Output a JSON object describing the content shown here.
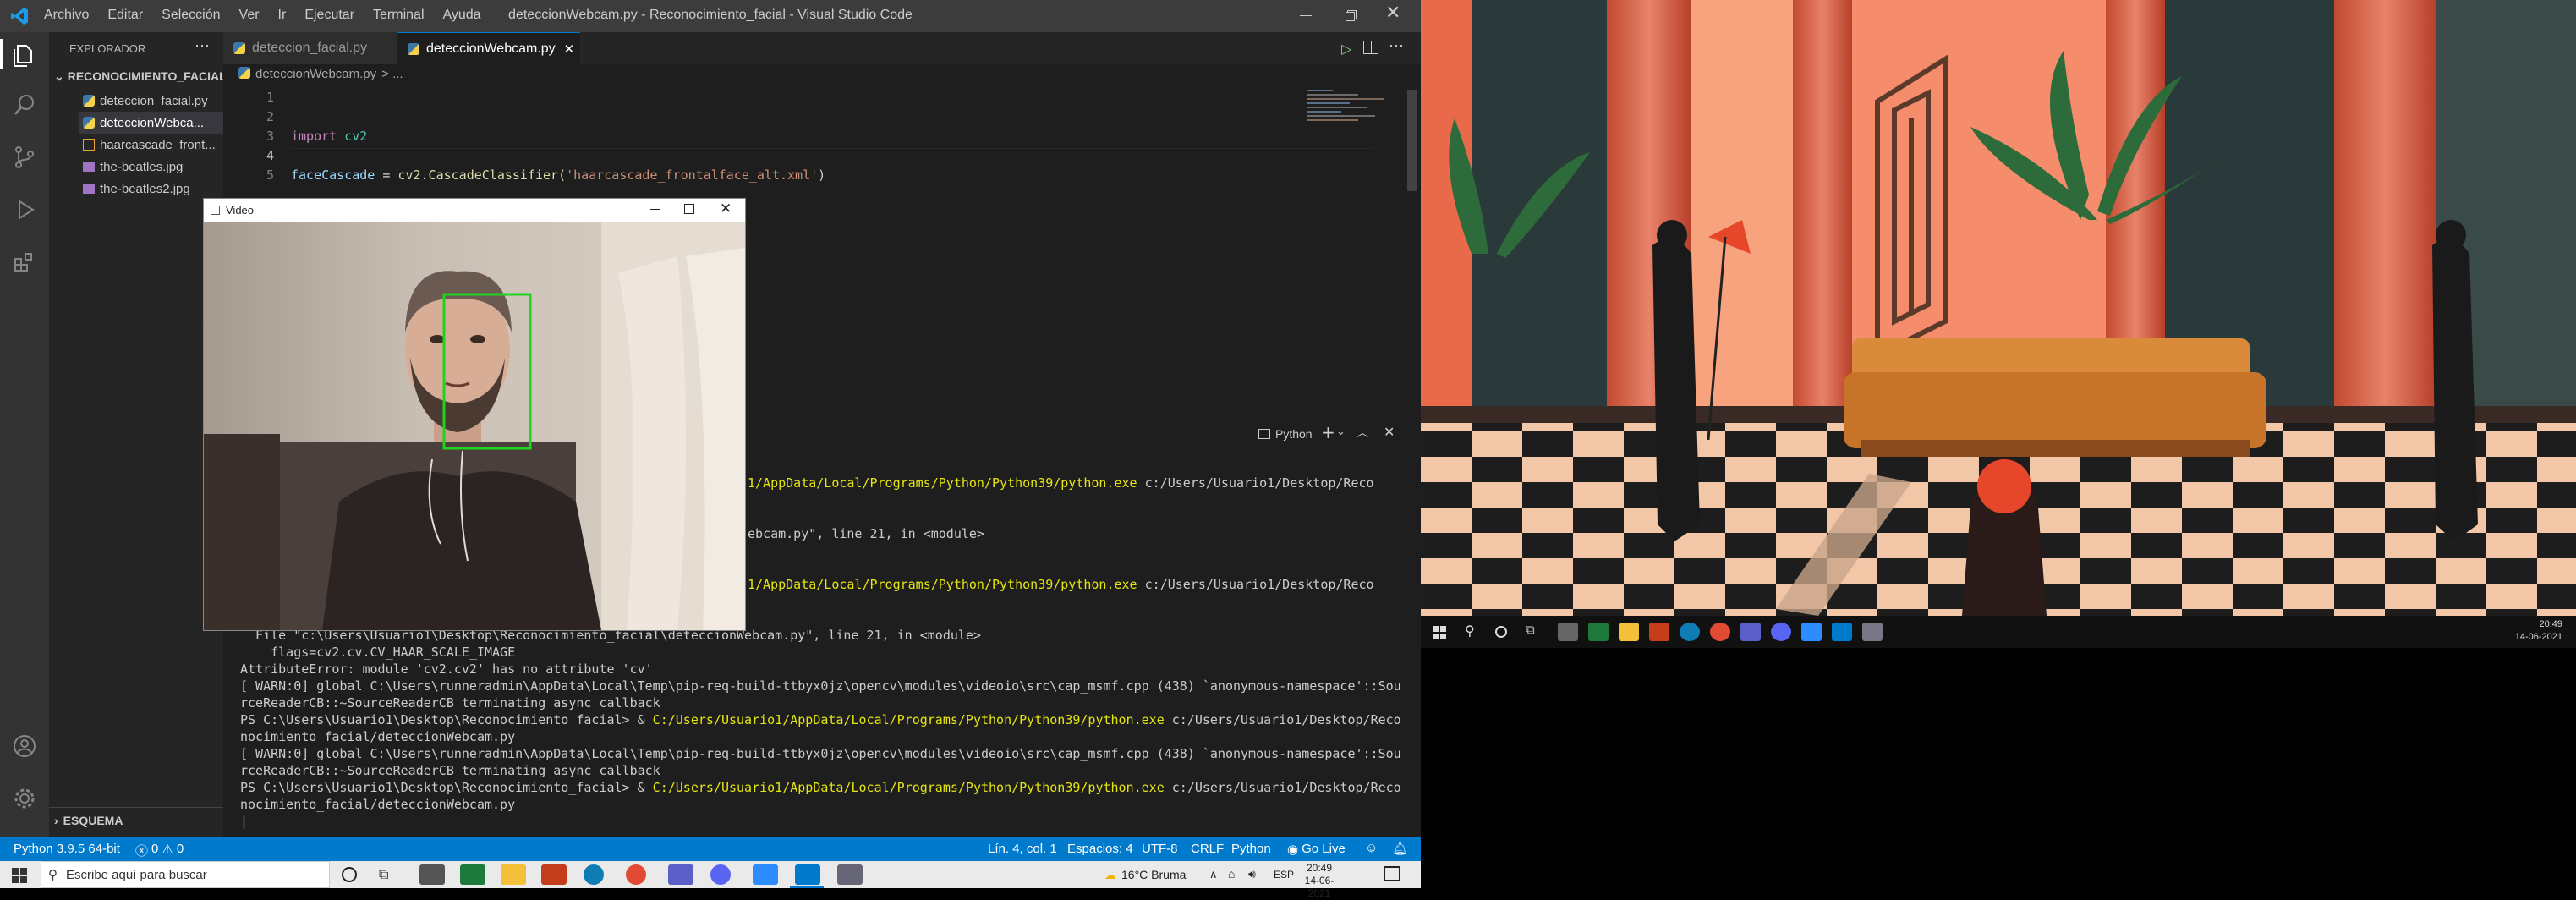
{
  "app": {
    "window_title": "deteccionWebcam.py - Reconocimiento_facial - Visual Studio Code"
  },
  "menu": [
    "Archivo",
    "Editar",
    "Selección",
    "Ver",
    "Ir",
    "Ejecutar",
    "Terminal",
    "Ayuda"
  ],
  "sidebar": {
    "header": "EXPLORADOR",
    "folder": "RECONOCIMIENTO_FACIAL",
    "files": [
      "deteccion_facial.py",
      "deteccionWebca...",
      "haarcascade_front...",
      "the-beatles.jpg",
      "the-beatles2.jpg"
    ],
    "outline": "ESQUEMA"
  },
  "tabs": [
    {
      "label": "deteccion_facial.py"
    },
    {
      "label": "deteccionWebcam.py"
    }
  ],
  "breadcrumb": {
    "file": "deteccionWebcam.py",
    "rest": "> ..."
  },
  "editor": {
    "line_numbers": [
      "1",
      "2",
      "3",
      "4",
      "5"
    ],
    "import_kw": "import",
    "import_mod": "cv2",
    "assign_var": "faceCascade",
    "assign_eq": " = ",
    "assign_call": "cv2.CascadeClassifier(",
    "assign_str": "'haarcascade_frontalface_alt.xml'",
    "assign_close": ")"
  },
  "video_window": {
    "title": "Video"
  },
  "panel": {
    "terminal_label": "Python"
  },
  "terminal": {
    "partial1a": "1/AppData/Local/Programs/Python/Python39/python.exe",
    "partial1b": " c:/Users/Usuario1/Desktop/Reco",
    "partial2": "ebcam.py\", line 21, in <module>",
    "partial3a": "1/AppData/Local/Programs/Python/Python39/python.exe",
    "partial3b": " c:/Users/Usuario1/Desktop/Reco",
    "lines": [
      "  File \"c:\\Users\\Usuario1\\Desktop\\Reconocimiento_facial\\deteccionWebcam.py\", line 21, in <module>",
      "    flags=cv2.cv.CV_HAAR_SCALE_IMAGE",
      "AttributeError: module 'cv2.cv2' has no attribute 'cv'",
      "[ WARN:0] global C:\\Users\\runneradmin\\AppData\\Local\\Temp\\pip-req-build-ttbyx0jz\\opencv\\modules\\videoio\\src\\cap_msmf.cpp (438) `anonymous-namespace'::Sou",
      "rceReaderCB::~SourceReaderCB terminating async callback"
    ],
    "ps_prefix": "PS C:\\Users\\Usuario1\\Desktop\\Reconocimiento_facial> & ",
    "ps_cmd": "C:/Users/Usuario1/AppData/Local/Programs/Python/Python39/python.exe",
    "ps_tail": " c:/Users/Usuario1/Desktop/Reco",
    "ps_cont": "nocimiento_facial/deteccionWebcam.py",
    "warn1": "[ WARN:0] global C:\\Users\\runneradmin\\AppData\\Local\\Temp\\pip-req-build-ttbyx0jz\\opencv\\modules\\videoio\\src\\cap_msmf.cpp (438) `anonymous-namespace'::Sou",
    "warn2": "rceReaderCB::~SourceReaderCB terminating async callback",
    "cursor": "|"
  },
  "status": {
    "python": "Python 3.9.5 64-bit",
    "errors": "0",
    "warnings": "0",
    "position": "Lín. 4, col. 1",
    "spaces": "Espacios: 4",
    "encoding": "UTF-8",
    "eol": "CRLF",
    "language": "Python",
    "golive": "Go Live"
  },
  "taskbar": {
    "search_placeholder": "Escribe aquí para buscar",
    "weather": "16°C  Bruma",
    "lang": "ESP",
    "time": "20:49",
    "date": "14-06-2021"
  },
  "right_taskbar": {
    "time": "20:49",
    "date": "14-06-2021"
  },
  "colors": {
    "accent": "#007acc",
    "keyword": "#c586c0",
    "string": "#ce9178",
    "function": "#dcdcaa",
    "variable": "#9cdcfe",
    "terminal_yellow": "#e5e510",
    "face_box": "#1fd41f"
  }
}
